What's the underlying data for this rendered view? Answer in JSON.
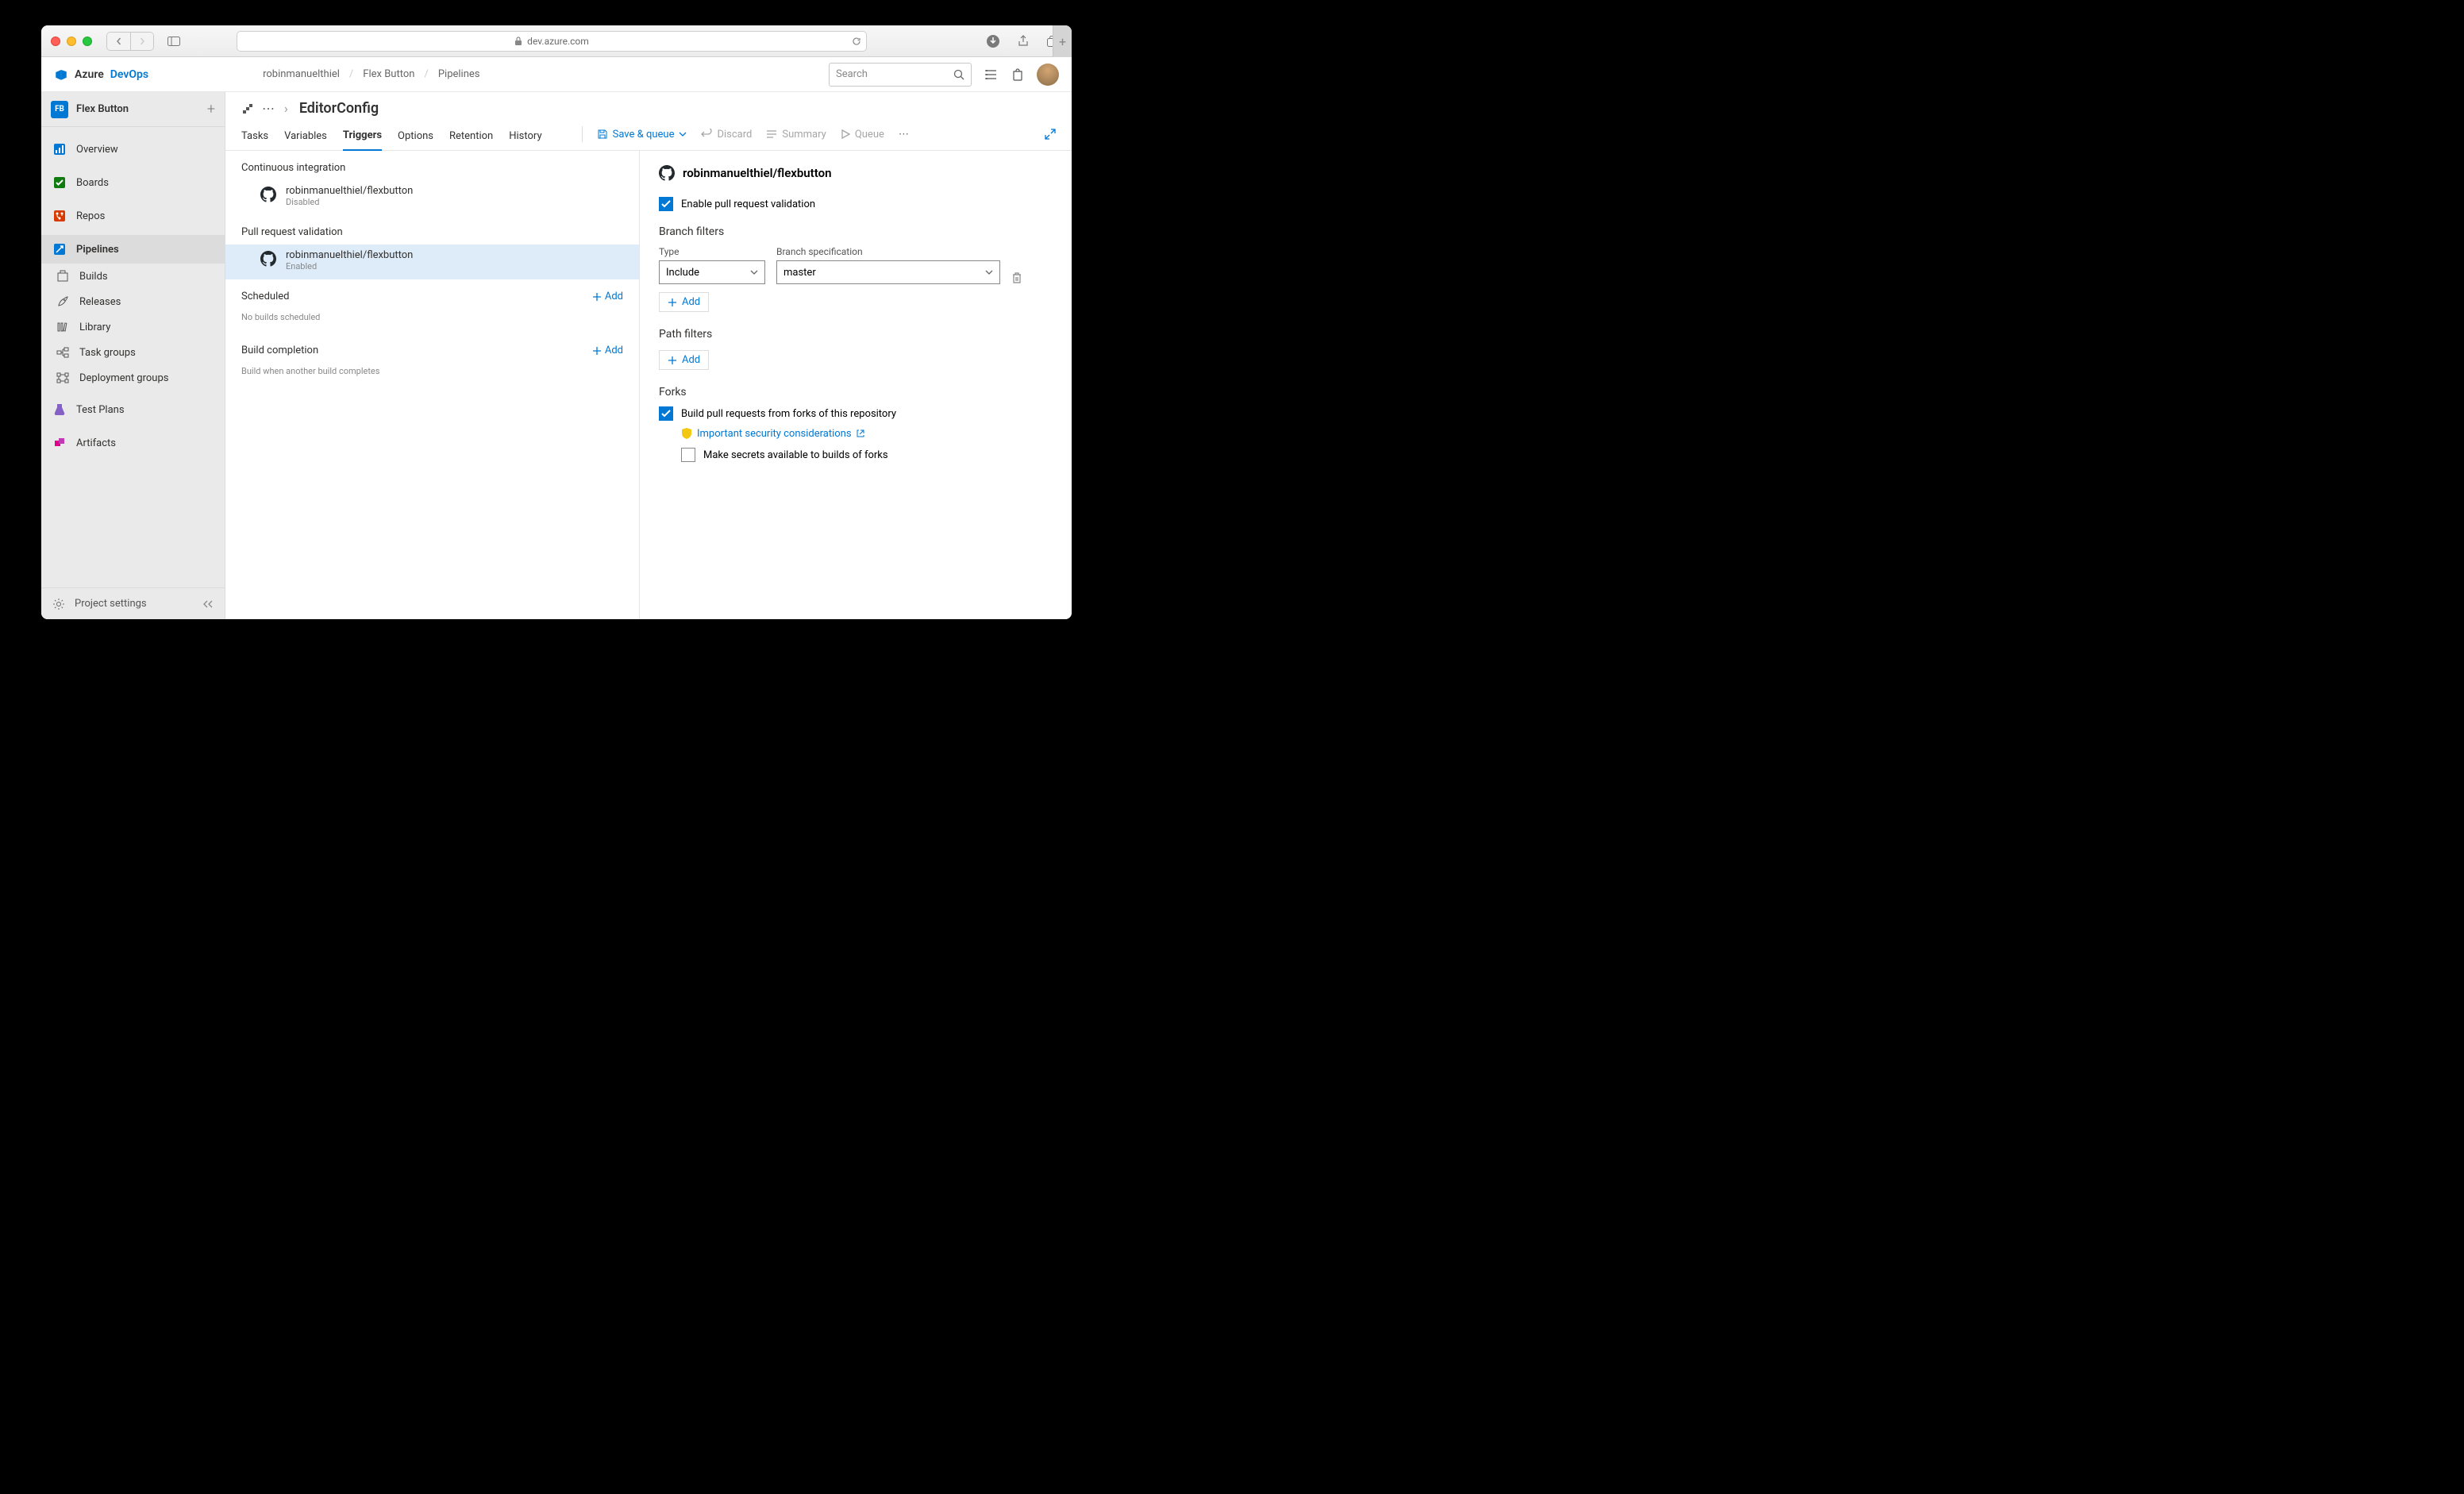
{
  "browser": {
    "url_host": "dev.azure.com"
  },
  "topnav": {
    "brand_azure": "Azure",
    "brand_devops": "DevOps",
    "crumbs": [
      "robinmanuelthiel",
      "Flex Button",
      "Pipelines"
    ],
    "search_placeholder": "Search"
  },
  "sidebar": {
    "project_badge": "FB",
    "project_name": "Flex Button",
    "items": [
      {
        "label": "Overview"
      },
      {
        "label": "Boards"
      },
      {
        "label": "Repos"
      },
      {
        "label": "Pipelines"
      },
      {
        "label": "Builds"
      },
      {
        "label": "Releases"
      },
      {
        "label": "Library"
      },
      {
        "label": "Task groups"
      },
      {
        "label": "Deployment groups"
      },
      {
        "label": "Test Plans"
      },
      {
        "label": "Artifacts"
      }
    ],
    "footer": "Project settings"
  },
  "page": {
    "title": "EditorConfig",
    "tabs": [
      "Tasks",
      "Variables",
      "Triggers",
      "Options",
      "Retention",
      "History"
    ],
    "actions": {
      "save": "Save & queue",
      "discard": "Discard",
      "summary": "Summary",
      "queue": "Queue"
    }
  },
  "triggers": {
    "ci_header": "Continuous integration",
    "ci_repo": "robinmanuelthiel/flexbutton",
    "ci_status": "Disabled",
    "pr_header": "Pull request validation",
    "pr_repo": "robinmanuelthiel/flexbutton",
    "pr_status": "Enabled",
    "scheduled_header": "Scheduled",
    "scheduled_empty": "No builds scheduled",
    "completion_header": "Build completion",
    "completion_empty": "Build when another build completes",
    "add": "Add"
  },
  "detail": {
    "repo_title": "robinmanuelthiel/flexbutton",
    "enable_label": "Enable pull request validation",
    "branch_filters_hdr": "Branch filters",
    "type_label": "Type",
    "type_value": "Include",
    "branch_label": "Branch specification",
    "branch_value": "master",
    "add": "Add",
    "path_filters_hdr": "Path filters",
    "forks_hdr": "Forks",
    "forks_build_label": "Build pull requests from forks of this repository",
    "security_link": "Important security considerations",
    "secrets_label": "Make secrets available to builds of forks"
  }
}
